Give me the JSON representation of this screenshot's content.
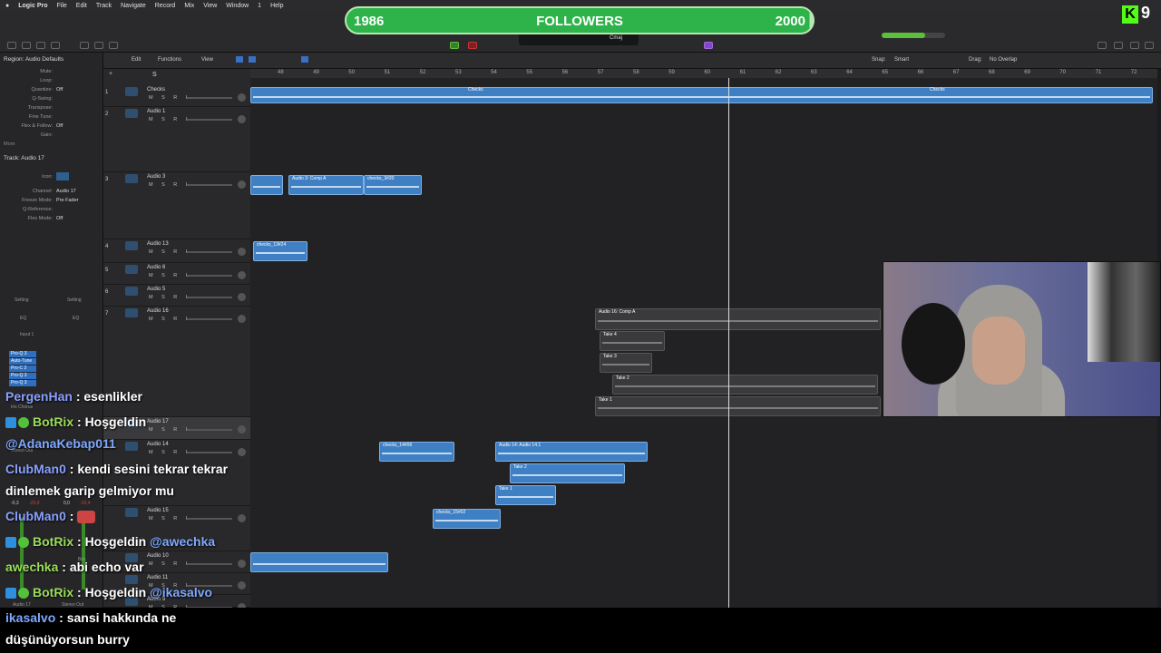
{
  "menubar": {
    "app": "Logic Pro",
    "items": [
      "File",
      "Edit",
      "Track",
      "Navigate",
      "Record",
      "Mix",
      "View",
      "Window",
      "1",
      "Help"
    ]
  },
  "overlay": {
    "followers_label": "FOLLOWERS",
    "followers_current": "1986",
    "followers_goal": "2000",
    "followers_progress": 0.993,
    "kick_count": "9",
    "kick_logo": "K"
  },
  "lcd": {
    "key": "Cmaj"
  },
  "inspector": {
    "region_title": "Region: Audio Defaults",
    "region_rows": [
      {
        "k": "Mute:",
        "v": ""
      },
      {
        "k": "Loop:",
        "v": ""
      },
      {
        "k": "Quantize:",
        "v": "Off"
      },
      {
        "k": "Q-Swing:",
        "v": ""
      },
      {
        "k": "Transpose:",
        "v": ""
      },
      {
        "k": "Fine Tune:",
        "v": ""
      },
      {
        "k": "Flex & Follow:",
        "v": "Off"
      },
      {
        "k": "Gain:",
        "v": ""
      }
    ],
    "more": "More",
    "track_title": "Track: Audio 17",
    "track_rows": [
      {
        "k": "Icon:",
        "v": ""
      },
      {
        "k": "Channel:",
        "v": "Audio 17"
      },
      {
        "k": "Freeze Mode:",
        "v": "Pre Fader"
      },
      {
        "k": "Q-Reference:",
        "v": ""
      },
      {
        "k": "Flex Mode:",
        "v": "Off"
      }
    ],
    "setting1": "Setting",
    "setting2": "Setting",
    "eq1": "EQ",
    "eq2": "EQ",
    "input": "Input 1",
    "plugins": [
      "Pro-Q 3",
      "Auto-Tune",
      "Pro-C 2",
      "Pro-Q 3",
      "Pro-Q 3"
    ],
    "strip_footer1": "Audio 17",
    "strip_footer2": "Stereo Out",
    "bnc": "Bnc",
    "vals": [
      "-0,3",
      "-29,9",
      "0,0",
      "-10,4"
    ],
    "bus": "Stereo Out",
    "chorus": "Iris Chorus"
  },
  "arrange_toolbar": {
    "edit": "Edit",
    "functions": "Functions",
    "view": "View",
    "snap_label": "Snap:",
    "snap_value": "Smart",
    "drag_label": "Drag:",
    "drag_value": "No Overlap"
  },
  "ruler": [
    "48",
    "49",
    "50",
    "51",
    "52",
    "53",
    "54",
    "55",
    "56",
    "57",
    "58",
    "59",
    "60",
    "61",
    "62",
    "63",
    "64",
    "65",
    "66",
    "67",
    "68",
    "69",
    "70",
    "71",
    "72"
  ],
  "tracks": [
    {
      "num": "1",
      "name": "Checks",
      "btns": "M S R I"
    },
    {
      "num": "2",
      "name": "Audio 1",
      "btns": "M S R I"
    },
    {
      "num": "3",
      "name": "Audio 3",
      "btns": "M S R I"
    },
    {
      "num": "4",
      "name": "Audio 13",
      "btns": "M S R I"
    },
    {
      "num": "5",
      "name": "Audio 6",
      "btns": "M S R I"
    },
    {
      "num": "6",
      "name": "Audio 5",
      "btns": "M S R I"
    },
    {
      "num": "7",
      "name": "Audio 16",
      "btns": "M S R I"
    },
    {
      "num": "",
      "name": "Audio 17",
      "btns": "M S R I"
    },
    {
      "num": "",
      "name": "Audio 14",
      "btns": "M S R I"
    },
    {
      "num": "",
      "name": "Audio 15",
      "btns": "M S R I"
    },
    {
      "num": "",
      "name": "Audio 10",
      "btns": "M S R I"
    },
    {
      "num": "",
      "name": "Audio 11",
      "btns": "M S R I"
    },
    {
      "num": "",
      "name": "Audio 9",
      "btns": "M S R I"
    }
  ],
  "regions": {
    "checks_a": "Checks",
    "checks_b": "Checks",
    "comp3": "Audio 3: Comp A",
    "checks3": "checks_3#20",
    "checks13": "checks_13#24",
    "comp16": "Audio 16: Comp A",
    "take4": "Take 4",
    "take3": "Take 3",
    "take2": "Take 2",
    "take1": "Take 1",
    "checks14": "checks_14#06",
    "comp14": "Audio 14: Audio 14.1",
    "take2b": "Take 2",
    "take1b": "Take 1",
    "checks15": "checks_15#02"
  },
  "chat": [
    {
      "user": "PergenHan",
      "msg": ": esenlikler"
    },
    {
      "user": "BotRix",
      "msg": ": Hoşgeldin",
      "mention": ""
    },
    {
      "user": "@AdanaKebap011",
      "msg": ""
    },
    {
      "user": "ClubMan0",
      "msg": ": kendi sesini tekrar tekrar"
    },
    {
      "user": "",
      "msg": "dinlemek garip gelmiyor mu"
    },
    {
      "user": "ClubMan0",
      "msg": ":"
    },
    {
      "user": "BotRix",
      "msg": ": Hoşgeldin ",
      "mention": "@awechka"
    },
    {
      "user": "awechka",
      "msg": ": abi echo var"
    },
    {
      "user": "BotRix",
      "msg": ": Hoşgeldin ",
      "mention": "@ikasalvo"
    },
    {
      "user": "ikasalvo",
      "msg": ": sansi hakkında ne"
    },
    {
      "user": "",
      "msg": "düşünüyorsun burry"
    }
  ]
}
